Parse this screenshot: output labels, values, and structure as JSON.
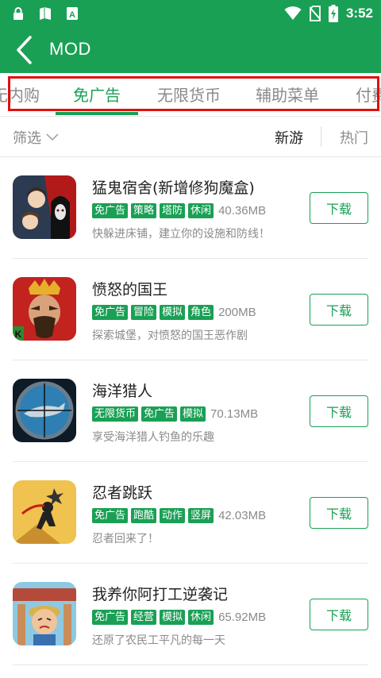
{
  "status": {
    "time": "3:52",
    "left_icons": [
      "lock-icon",
      "sim-card-icon",
      "app-a-icon"
    ],
    "right_icons": [
      "wifi-icon",
      "no-sim-icon",
      "battery-charging-icon"
    ]
  },
  "appbar": {
    "title": "MOD",
    "back_icon": "chevron-left-icon"
  },
  "tabs": [
    {
      "label": "无内购",
      "active": false
    },
    {
      "label": "免广告",
      "active": true
    },
    {
      "label": "无限货币",
      "active": false
    },
    {
      "label": "辅助菜单",
      "active": false
    },
    {
      "label": "付费",
      "active": false
    }
  ],
  "filter": {
    "label": "筛选",
    "sort_new": "新游",
    "sort_hot": "热门"
  },
  "download_label": "下载",
  "apps": [
    {
      "name": "猛鬼宿舍(新增修狗魔盒)",
      "tags": [
        "免广告",
        "策略",
        "塔防",
        "休闲"
      ],
      "size": "40.36MB",
      "desc": "快躲进床铺，建立你的设施和防线！"
    },
    {
      "name": "愤怒的国王",
      "tags": [
        "免广告",
        "冒险",
        "模拟",
        "角色"
      ],
      "size": "200MB",
      "desc": "探索城堡，对愤怒的国王恶作剧"
    },
    {
      "name": "海洋猎人",
      "tags": [
        "无限货币",
        "免广告",
        "模拟"
      ],
      "size": "70.13MB",
      "desc": "享受海洋猎人钓鱼的乐趣"
    },
    {
      "name": "忍者跳跃",
      "tags": [
        "免广告",
        "跑酷",
        "动作",
        "竖屏"
      ],
      "size": "42.03MB",
      "desc": "忍者回来了！"
    },
    {
      "name": "我养你阿打工逆袭记",
      "tags": [
        "免广告",
        "经营",
        "模拟",
        "休闲"
      ],
      "size": "65.92MB",
      "desc": "还原了农民工平凡的每一天"
    }
  ],
  "colors": {
    "brand": "#1aa055",
    "highlight_box": "#e01010",
    "muted_text": "#8a8a8a"
  }
}
